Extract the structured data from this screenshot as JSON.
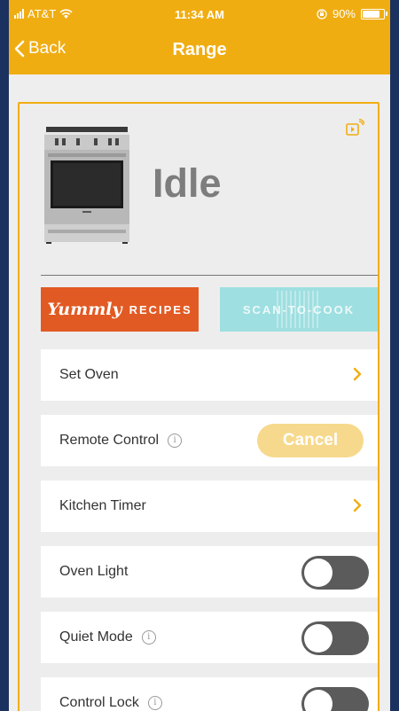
{
  "status_bar": {
    "carrier": "AT&T",
    "time": "11:34 AM",
    "battery": "90%",
    "battery_level": 0.9
  },
  "nav": {
    "back_label": "Back",
    "title": "Range"
  },
  "appliance": {
    "state": "Idle"
  },
  "buttons": {
    "yummly_brand": "Yummly",
    "yummly_sub": "RECIPES",
    "scan": "SCAN-TO-COOK"
  },
  "rows": {
    "set_oven": "Set Oven",
    "remote_control": "Remote Control",
    "cancel": "Cancel",
    "kitchen_timer": "Kitchen Timer",
    "oven_light": "Oven Light",
    "quiet_mode": "Quiet Mode",
    "control_lock": "Control Lock"
  },
  "toggles": {
    "oven_light": false,
    "quiet_mode": false,
    "control_lock": false
  },
  "colors": {
    "accent": "#f0ad12",
    "yummly": "#e25a23",
    "scan": "#9edfe1",
    "background": "#1b3260"
  },
  "icons": {
    "info": "info-icon",
    "chevron": "chevron-right-icon",
    "cast": "cast-icon"
  }
}
